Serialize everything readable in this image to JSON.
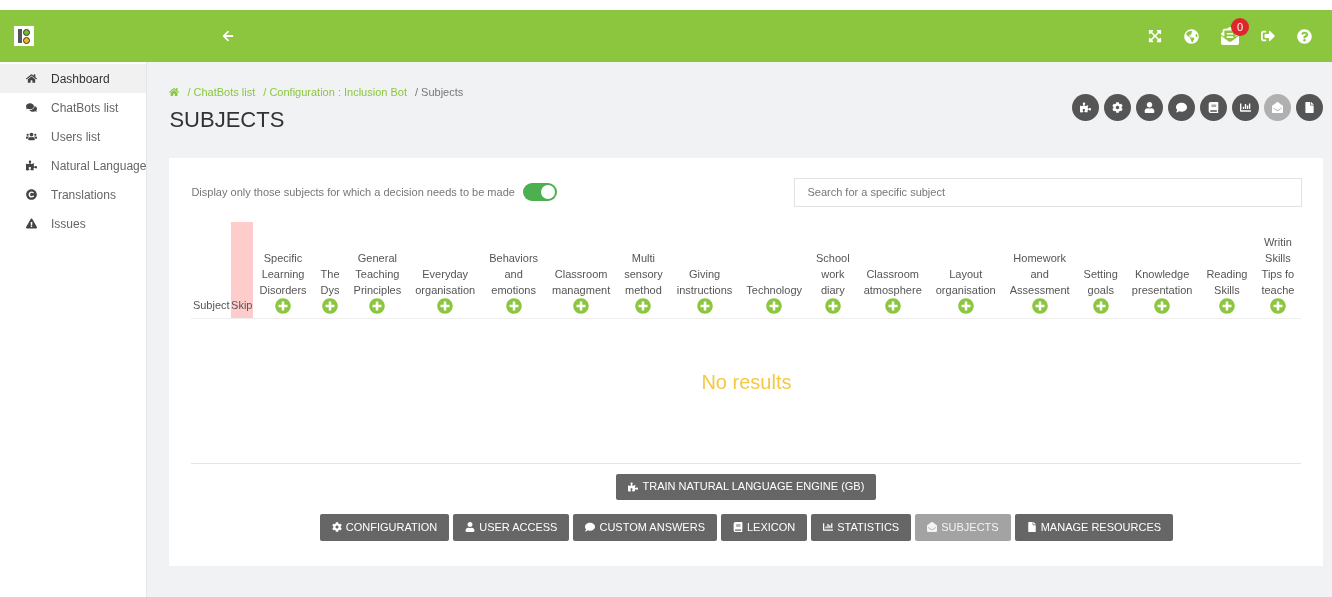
{
  "topbar": {
    "badge": "0"
  },
  "sidebar": {
    "items": [
      {
        "label": "Dashboard",
        "selected": true
      },
      {
        "label": "ChatBots list",
        "selected": false
      },
      {
        "label": "Users list",
        "selected": false
      },
      {
        "label": "Natural Language",
        "selected": false
      },
      {
        "label": "Translations",
        "selected": false
      },
      {
        "label": "Issues",
        "selected": false
      }
    ]
  },
  "breadcrumb": [
    "/ ChatBots list",
    "/ Configuration : Inclusion Bot",
    "/ Subjects"
  ],
  "title": "SUBJECTS",
  "toolbar": [
    {
      "disabled": false
    },
    {
      "disabled": false
    },
    {
      "disabled": false
    },
    {
      "disabled": false
    },
    {
      "disabled": false
    },
    {
      "disabled": false
    },
    {
      "disabled": true
    },
    {
      "disabled": false
    }
  ],
  "filter": {
    "label": "Display only those subjects for which a decision needs to be made",
    "on": true
  },
  "search": {
    "placeholder": "Search for a specific subject"
  },
  "table": {
    "subject_column": "Subject",
    "skip_column": "Skip",
    "columns": [
      [
        "Specific",
        "Learning",
        "Disorders"
      ],
      [
        "The",
        "Dys"
      ],
      [
        "General",
        "Teaching",
        "Principles"
      ],
      [
        "Everyday",
        "organisation"
      ],
      [
        "Behaviors",
        "and",
        "emotions"
      ],
      [
        "Classroom",
        "managment"
      ],
      [
        "Multi",
        "sensory",
        "method"
      ],
      [
        "Giving",
        "instructions"
      ],
      [
        "Technology"
      ],
      [
        "School",
        "work",
        "diary"
      ],
      [
        "Classroom",
        "atmosphere"
      ],
      [
        "Layout",
        "organisation"
      ],
      [
        "Homework",
        "and",
        "Assessment"
      ],
      [
        "Setting",
        "goals"
      ],
      [
        "Knowledge",
        "presentation"
      ],
      [
        "Reading",
        "Skills"
      ],
      [
        "Writin",
        "Skills",
        "Tips fo",
        "teache"
      ]
    ],
    "empty": "No results"
  },
  "train_button": "TRAIN NATURAL LANGUAGE ENGINE (GB)",
  "buttons": [
    {
      "label": "CONFIGURATION",
      "disabled": false
    },
    {
      "label": "USER ACCESS",
      "disabled": false
    },
    {
      "label": "CUSTOM ANSWERS",
      "disabled": false
    },
    {
      "label": "LEXICON",
      "disabled": false
    },
    {
      "label": "STATISTICS",
      "disabled": false
    },
    {
      "label": "SUBJECTS",
      "disabled": true
    },
    {
      "label": "MANAGE RESOURCES",
      "disabled": false
    }
  ]
}
